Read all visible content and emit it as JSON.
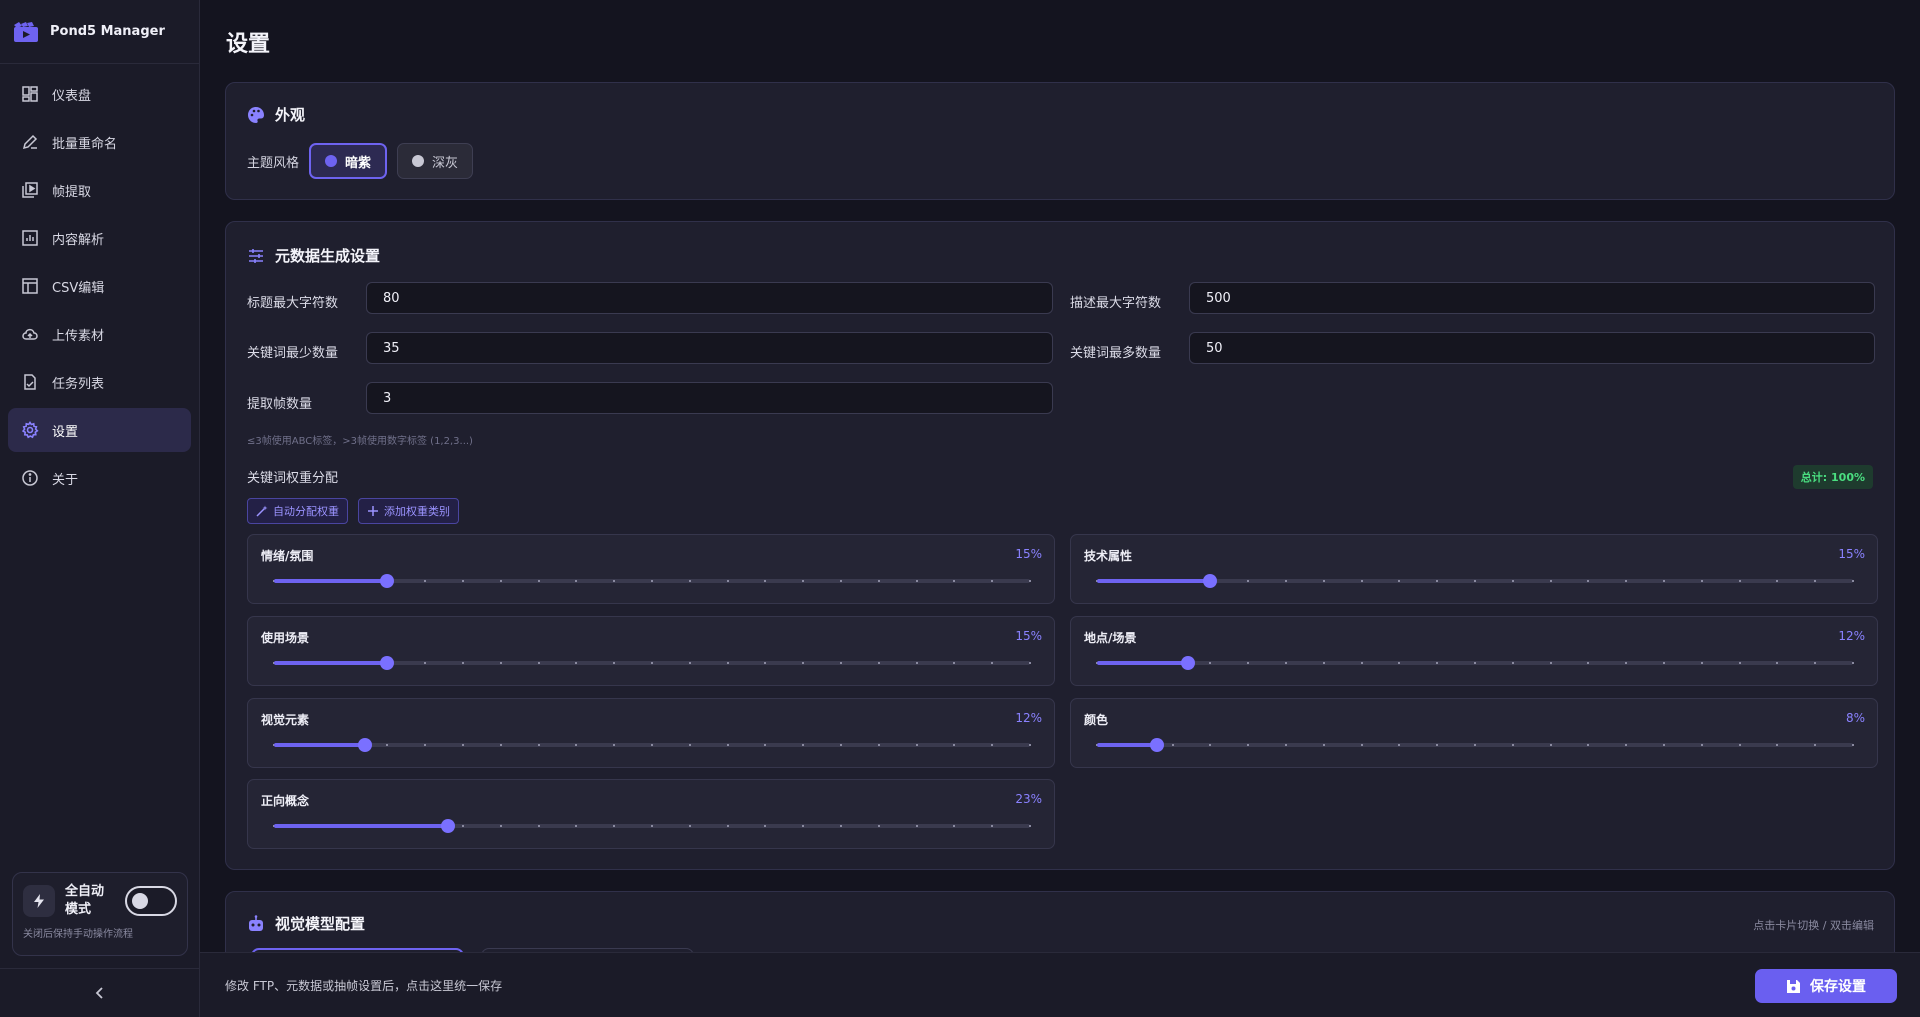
{
  "brand": {
    "name": "Pond5 Manager"
  },
  "nav": [
    {
      "label": "仪表盘",
      "icon": "dashboard-icon"
    },
    {
      "label": "批量重命名",
      "icon": "edit-icon"
    },
    {
      "label": "帧提取",
      "icon": "frames-icon"
    },
    {
      "label": "内容解析",
      "icon": "analysis-icon"
    },
    {
      "label": "CSV编辑",
      "icon": "table-icon"
    },
    {
      "label": "上传素材",
      "icon": "cloud-upload-icon"
    },
    {
      "label": "任务列表",
      "icon": "task-list-icon"
    },
    {
      "label": "设置",
      "icon": "gear-icon",
      "active": true
    },
    {
      "label": "关于",
      "icon": "info-icon"
    }
  ],
  "auto_mode": {
    "label": "全自动模式",
    "hint": "关闭后保持手动操作流程",
    "enabled": false
  },
  "page": {
    "title": "设置"
  },
  "appearance": {
    "title": "外观",
    "theme_label": "主题风格",
    "options": [
      {
        "label": "暗紫",
        "color": "#6e63f0",
        "selected": true
      },
      {
        "label": "深灰",
        "color": "#c8c8d4",
        "selected": false
      }
    ]
  },
  "metadata": {
    "title": "元数据生成设置",
    "fields": {
      "title_max": {
        "label": "标题最大字符数",
        "value": "80"
      },
      "desc_max": {
        "label": "描述最大字符数",
        "value": "500"
      },
      "kw_min": {
        "label": "关键词最少数量",
        "value": "35"
      },
      "kw_max": {
        "label": "关键词最多数量",
        "value": "50"
      },
      "frames": {
        "label": "提取帧数量",
        "value": "3"
      }
    },
    "frames_hint": "≤3帧使用ABC标签，>3帧使用数字标签 (1,2,3...)",
    "weights_label": "关键词权重分配",
    "total_badge": "总计: 100%",
    "auto_weight_btn": "自动分配权重",
    "add_category_btn": "添加权重类别",
    "weights": [
      {
        "name": "情绪/氛围",
        "percent": 15,
        "percent_label": "15%"
      },
      {
        "name": "技术属性",
        "percent": 15,
        "percent_label": "15%"
      },
      {
        "name": "使用场景",
        "percent": 15,
        "percent_label": "15%"
      },
      {
        "name": "地点/场景",
        "percent": 12,
        "percent_label": "12%"
      },
      {
        "name": "视觉元素",
        "percent": 12,
        "percent_label": "12%"
      },
      {
        "name": "颜色",
        "percent": 8,
        "percent_label": "8%"
      },
      {
        "name": "正向概念",
        "percent": 23,
        "percent_label": "23%"
      }
    ]
  },
  "vision_model": {
    "title": "视觉模型配置",
    "hint": "点击卡片切换 / 双击编辑"
  },
  "bottom": {
    "text": "修改 FTP、元数据或抽帧设置后，点击这里统一保存",
    "save_label": "保存设置"
  },
  "colors": {
    "accent": "#6e63f0",
    "success": "#4ade80"
  }
}
